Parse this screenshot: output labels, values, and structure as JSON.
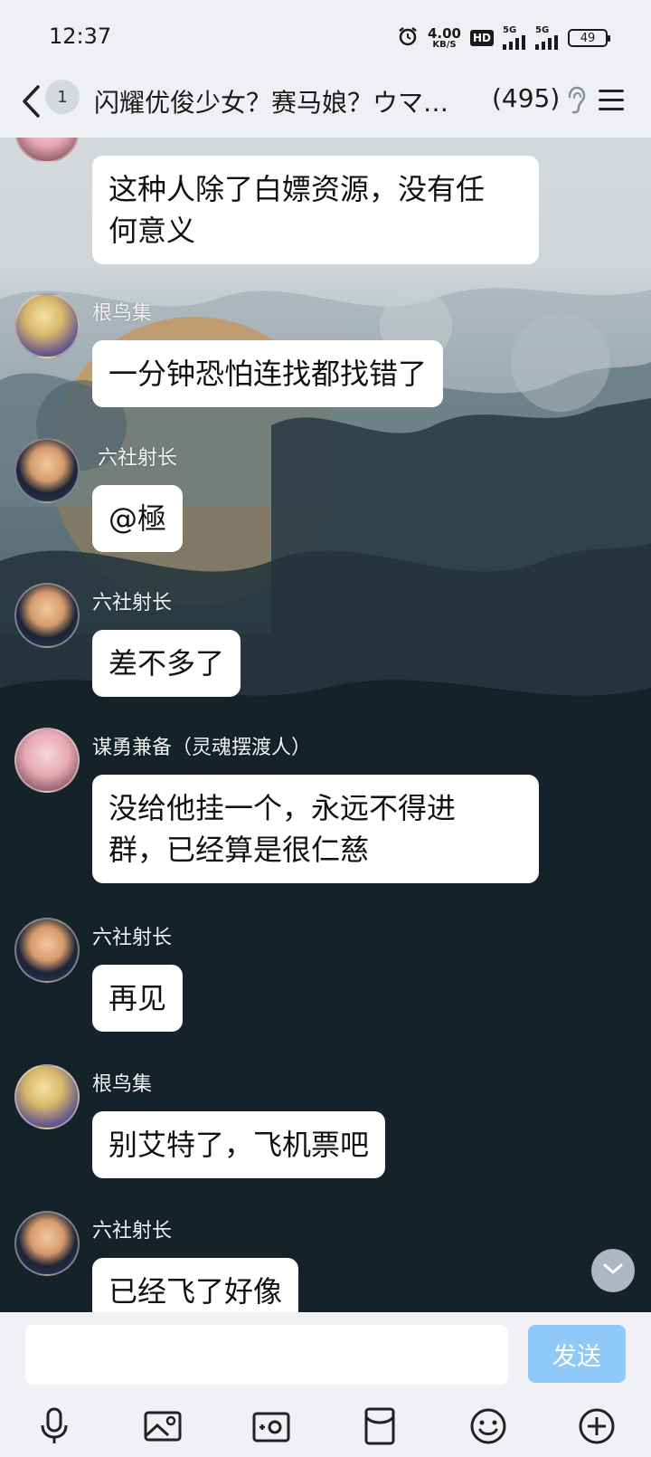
{
  "status_bar": {
    "time": "12:37",
    "net_speed_value": "4.00",
    "net_speed_unit": "KB/S",
    "hd_badge": "HD",
    "signal1_label": "5G",
    "signal2_label": "5G",
    "battery": "49",
    "icons": [
      "alarm-icon",
      "hd-icon",
      "signal-icon",
      "signal-icon",
      "battery-icon"
    ]
  },
  "header": {
    "unread_count": "1",
    "title": "闪耀优俊少女？赛马娘？ウマ…",
    "member_count": "(495)",
    "icons": [
      "back-icon",
      "ear-icon",
      "menu-icon"
    ]
  },
  "messages": [
    {
      "sender": "",
      "text_lines": [
        "这种人除了白嫖资源，没有任",
        "何意义"
      ],
      "avatar": "anime-girl"
    },
    {
      "sender": "根鸟集",
      "text_lines": [
        "一分钟恐怕连找都找错了"
      ],
      "avatar": "anime-blonde"
    },
    {
      "sender": "六社射长",
      "text_lines": [
        "@極"
      ],
      "avatar": "lawyer"
    },
    {
      "sender": "六社射长",
      "text_lines": [
        "差不多了"
      ],
      "avatar": "lawyer"
    },
    {
      "sender": "谋勇兼备（灵魂摆渡人）",
      "text_lines": [
        "没给他挂一个，永远不得进",
        "群，已经算是很仁慈"
      ],
      "avatar": "anime-girl"
    },
    {
      "sender": "六社射长",
      "text_lines": [
        "再见"
      ],
      "avatar": "lawyer"
    },
    {
      "sender": "根鸟集",
      "text_lines": [
        "别艾特了，飞机票吧"
      ],
      "avatar": "anime-blonde"
    },
    {
      "sender": "六社射长",
      "text_lines": [
        "已经飞了好像"
      ],
      "avatar": "lawyer"
    }
  ],
  "input": {
    "value": "",
    "placeholder": "",
    "send_label": "发送"
  },
  "toolbar": {
    "items": [
      "microphone-icon",
      "image-icon",
      "camera-icon",
      "red-packet-icon",
      "emoji-icon",
      "plus-icon"
    ]
  },
  "colors": {
    "bubble": "#ffffff",
    "send_button": "#8ec9f7",
    "background_dark": "#14212a",
    "accent_orange": "#f08a1c"
  }
}
